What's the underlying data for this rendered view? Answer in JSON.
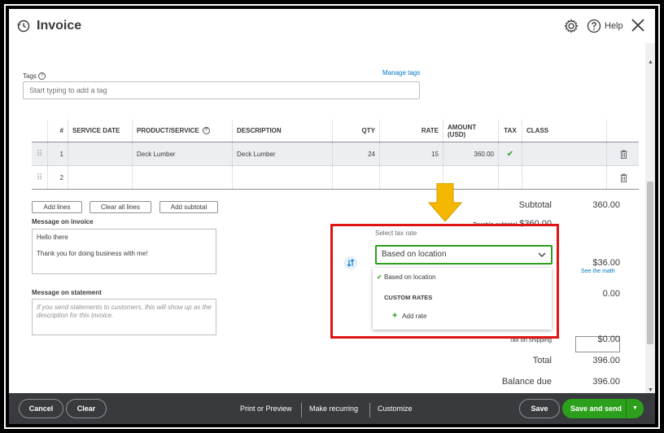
{
  "header": {
    "title": "Invoice",
    "help_label": "Help"
  },
  "tags": {
    "label": "Tags",
    "manage_link": "Manage tags",
    "placeholder": "Start typing to add a tag"
  },
  "table": {
    "columns": [
      "#",
      "SERVICE DATE",
      "PRODUCT/SERVICE",
      "DESCRIPTION",
      "QTY",
      "RATE",
      "AMOUNT (USD)",
      "TAX",
      "CLASS"
    ],
    "rows": [
      {
        "num": "1",
        "service_date": "",
        "product": "Deck Lumber",
        "description": "Deck Lumber",
        "qty": "24",
        "rate": "15",
        "amount": "360.00",
        "tax_checked": true,
        "class": ""
      },
      {
        "num": "2",
        "service_date": "",
        "product": "",
        "description": "",
        "qty": "",
        "rate": "",
        "amount": "",
        "tax_checked": false,
        "class": ""
      }
    ]
  },
  "actions": {
    "add_lines": "Add lines",
    "clear_all_lines": "Clear all lines",
    "add_subtotal": "Add subtotal"
  },
  "messages": {
    "invoice_label": "Message on invoice",
    "invoice_text_line1": "Hello there",
    "invoice_text_line2": "Thank you for doing business with me!",
    "statement_label": "Message on statement",
    "statement_placeholder": "If you send statements to customers, this will show up as the description for this invoice."
  },
  "summary": {
    "subtotal_label": "Subtotal",
    "subtotal_value": "360.00",
    "taxable_subtotal_label": "Taxable subtotal",
    "taxable_subtotal_value": "$360.00",
    "tax_value": "$36.00",
    "see_math": "See the math",
    "discount_value": "0.00",
    "tax_on_shipping_label": "Tax on shipping",
    "tax_on_shipping_value": "$0.00",
    "total_label": "Total",
    "total_value": "396.00",
    "balance_due_label": "Balance due",
    "balance_due_value": "396.00"
  },
  "tax_rate": {
    "label": "Select tax rate",
    "selected": "Based on location",
    "options": {
      "based_on_location": "Based on location",
      "custom_rates_header": "CUSTOM RATES",
      "add_rate": "Add rate"
    }
  },
  "footer": {
    "cancel": "Cancel",
    "clear": "Clear",
    "print_preview": "Print or Preview",
    "make_recurring": "Make recurring",
    "customize": "Customize",
    "save": "Save",
    "save_and_send": "Save and send"
  },
  "colors": {
    "accent_green": "#2ca01c",
    "link_blue": "#0077c5",
    "highlight_red": "#e01414",
    "arrow_yellow": "#f5b800",
    "footer_bg": "#393a3d"
  }
}
